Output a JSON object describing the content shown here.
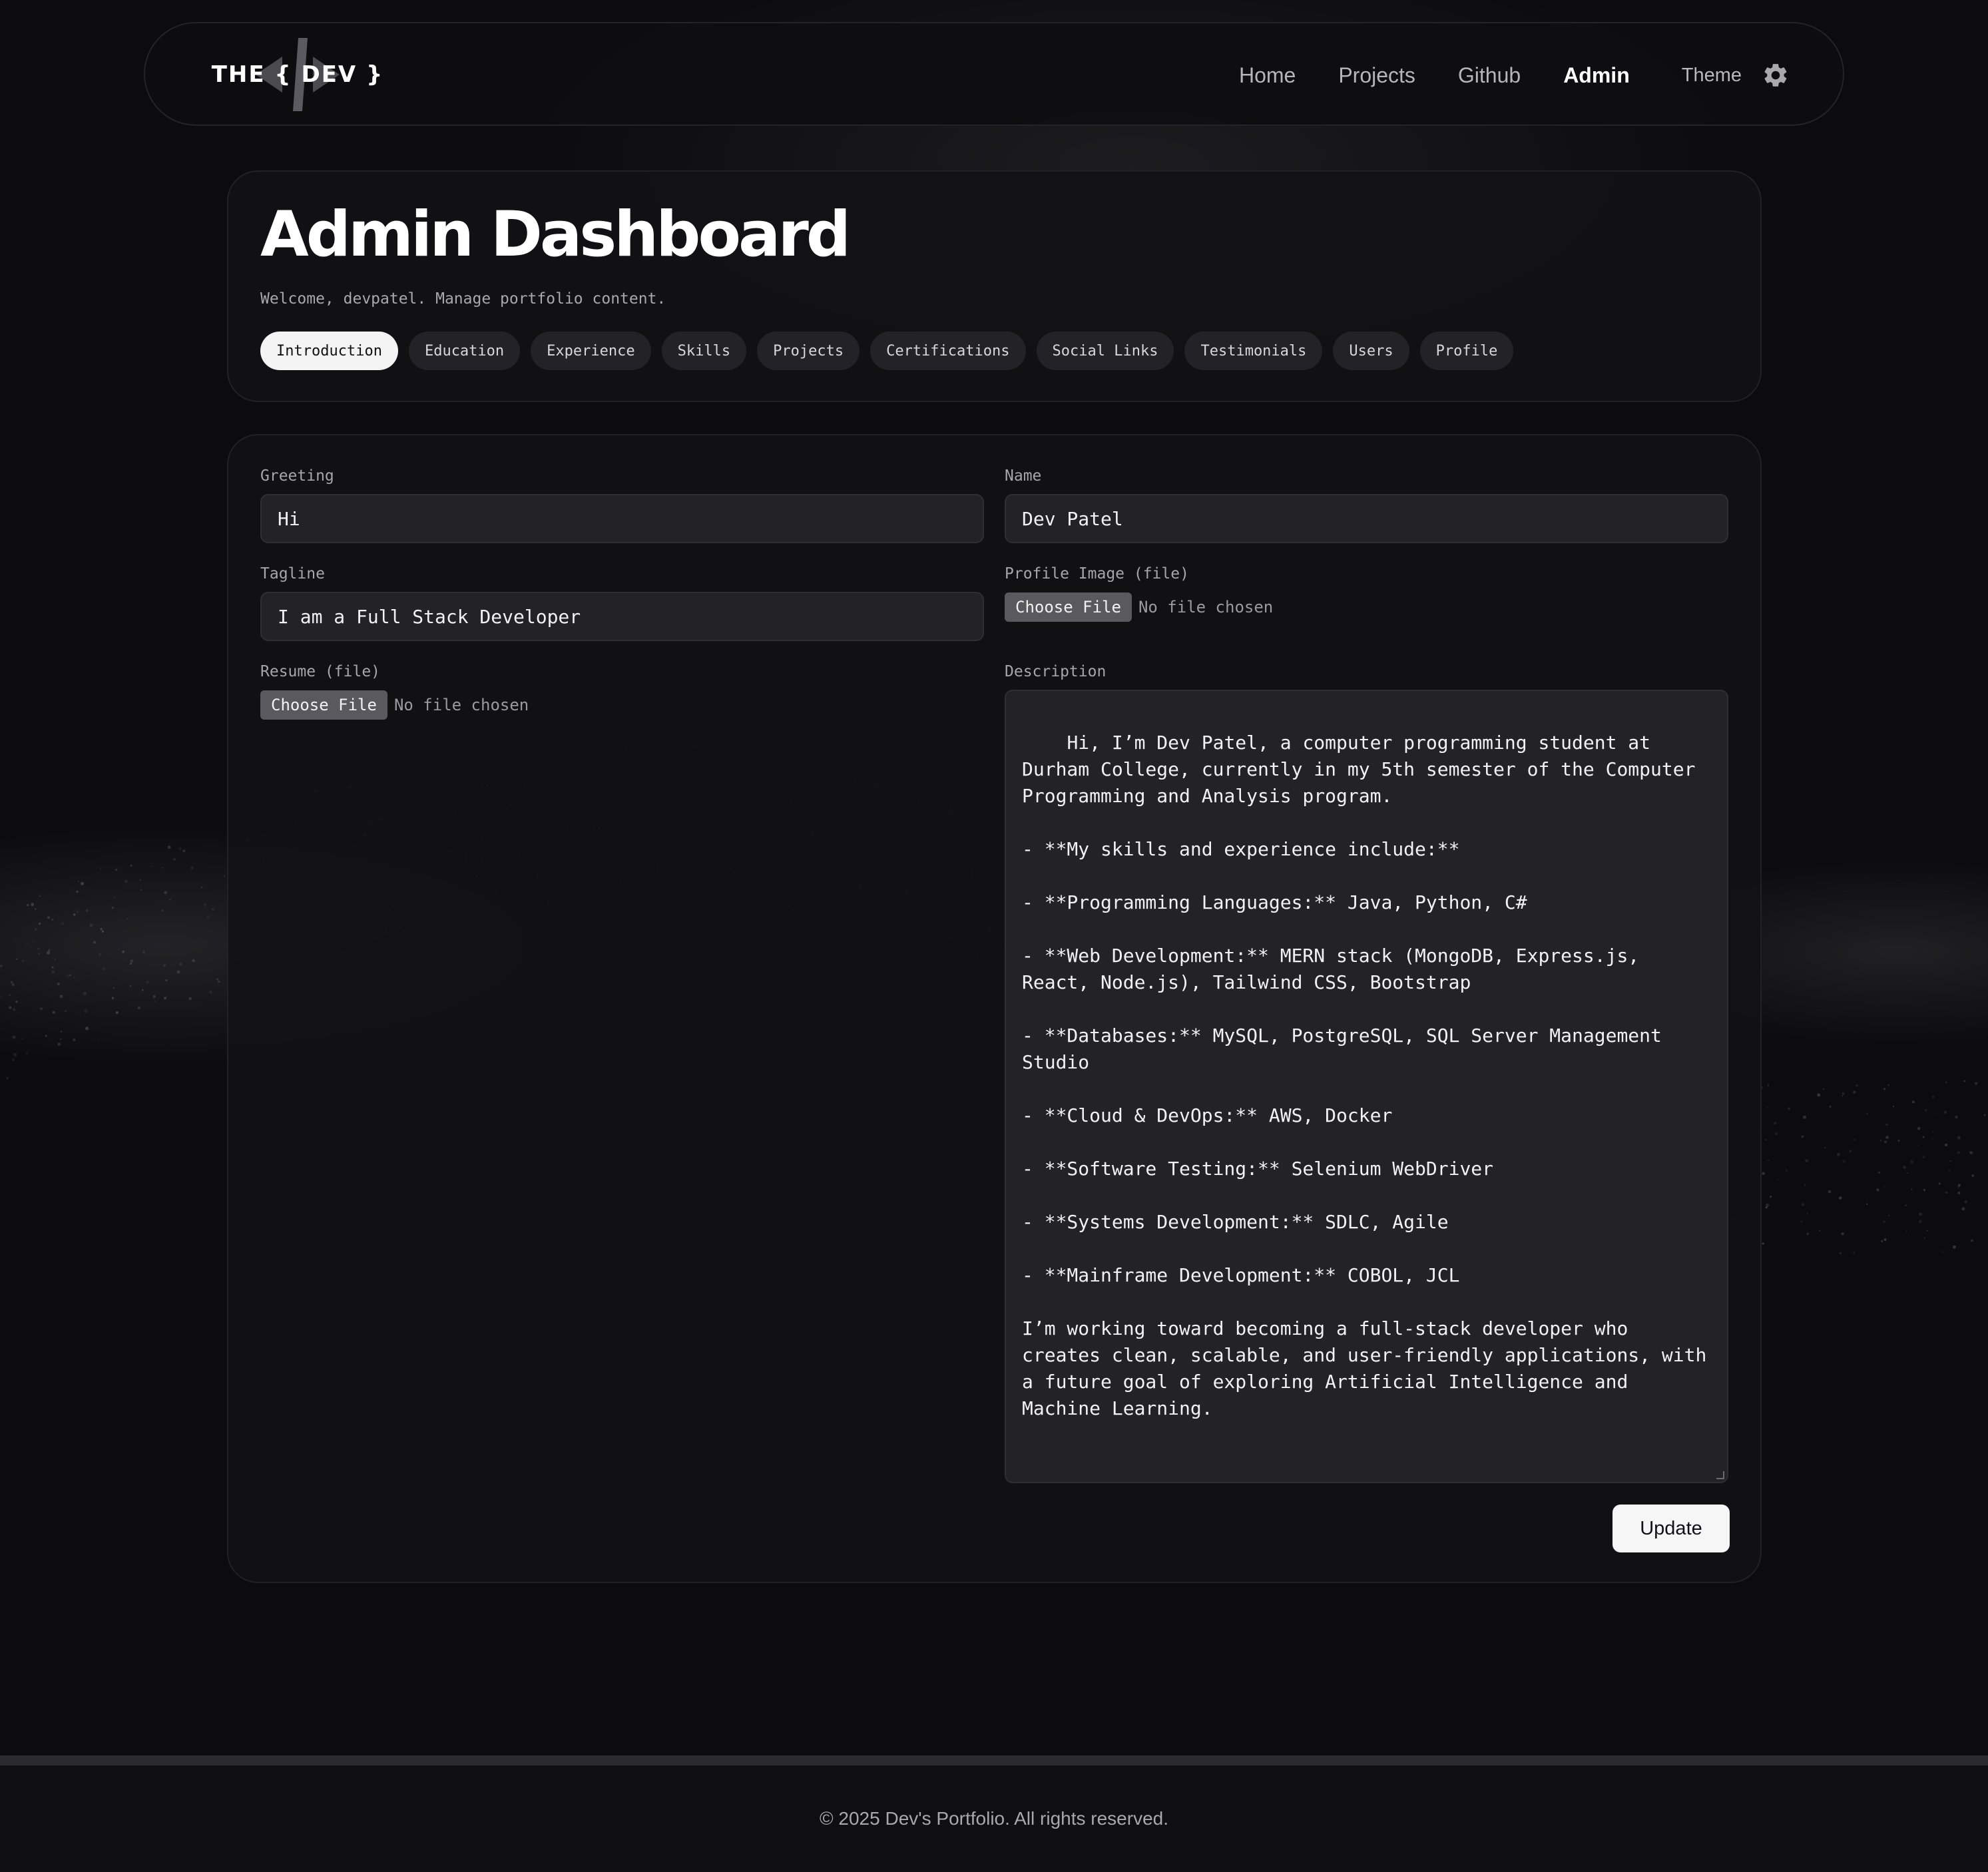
{
  "nav": {
    "logo_text": "THE { DEV }",
    "links": [
      "Home",
      "Projects",
      "Github",
      "Admin"
    ],
    "active_link": "Admin",
    "theme_label": "Theme"
  },
  "header": {
    "title": "Admin Dashboard",
    "welcome": "Welcome, devpatel. Manage portfolio content.",
    "tabs": [
      "Introduction",
      "Education",
      "Experience",
      "Skills",
      "Projects",
      "Certifications",
      "Social Links",
      "Testimonials",
      "Users",
      "Profile"
    ],
    "active_tab": "Introduction"
  },
  "form": {
    "greeting_label": "Greeting",
    "greeting_value": "Hi",
    "name_label": "Name",
    "name_value": "Dev Patel",
    "tagline_label": "Tagline",
    "tagline_value": "I am a Full Stack Developer",
    "profile_image_label": "Profile Image (file)",
    "resume_label": "Resume (file)",
    "file_button": "Choose File",
    "file_status": "No file chosen",
    "description_label": "Description",
    "description_value": "Hi, I’m Dev Patel, a computer programming student at Durham College, currently in my 5th semester of the Computer Programming and Analysis program.\n\n- **My skills and experience include:**\n\n- **Programming Languages:** Java, Python, C#\n\n- **Web Development:** MERN stack (MongoDB, Express.js, React, Node.js), Tailwind CSS, Bootstrap\n\n- **Databases:** MySQL, PostgreSQL, SQL Server Management Studio\n\n- **Cloud & DevOps:** AWS, Docker\n\n- **Software Testing:** Selenium WebDriver\n\n- **Systems Development:** SDLC, Agile\n\n- **Mainframe Development:** COBOL, JCL\n\nI’m working toward becoming a full-stack developer who creates clean, scalable, and user-friendly applications, with a future goal of exploring Artificial Intelligence and Machine Learning.",
    "update_button": "Update"
  },
  "footer": {
    "text": "© 2025 Dev's Portfolio. All rights reserved."
  },
  "colors": {
    "background": "#0c0c0e",
    "card": "#121214",
    "input": "#232326",
    "accent": "#f4f4f5"
  }
}
